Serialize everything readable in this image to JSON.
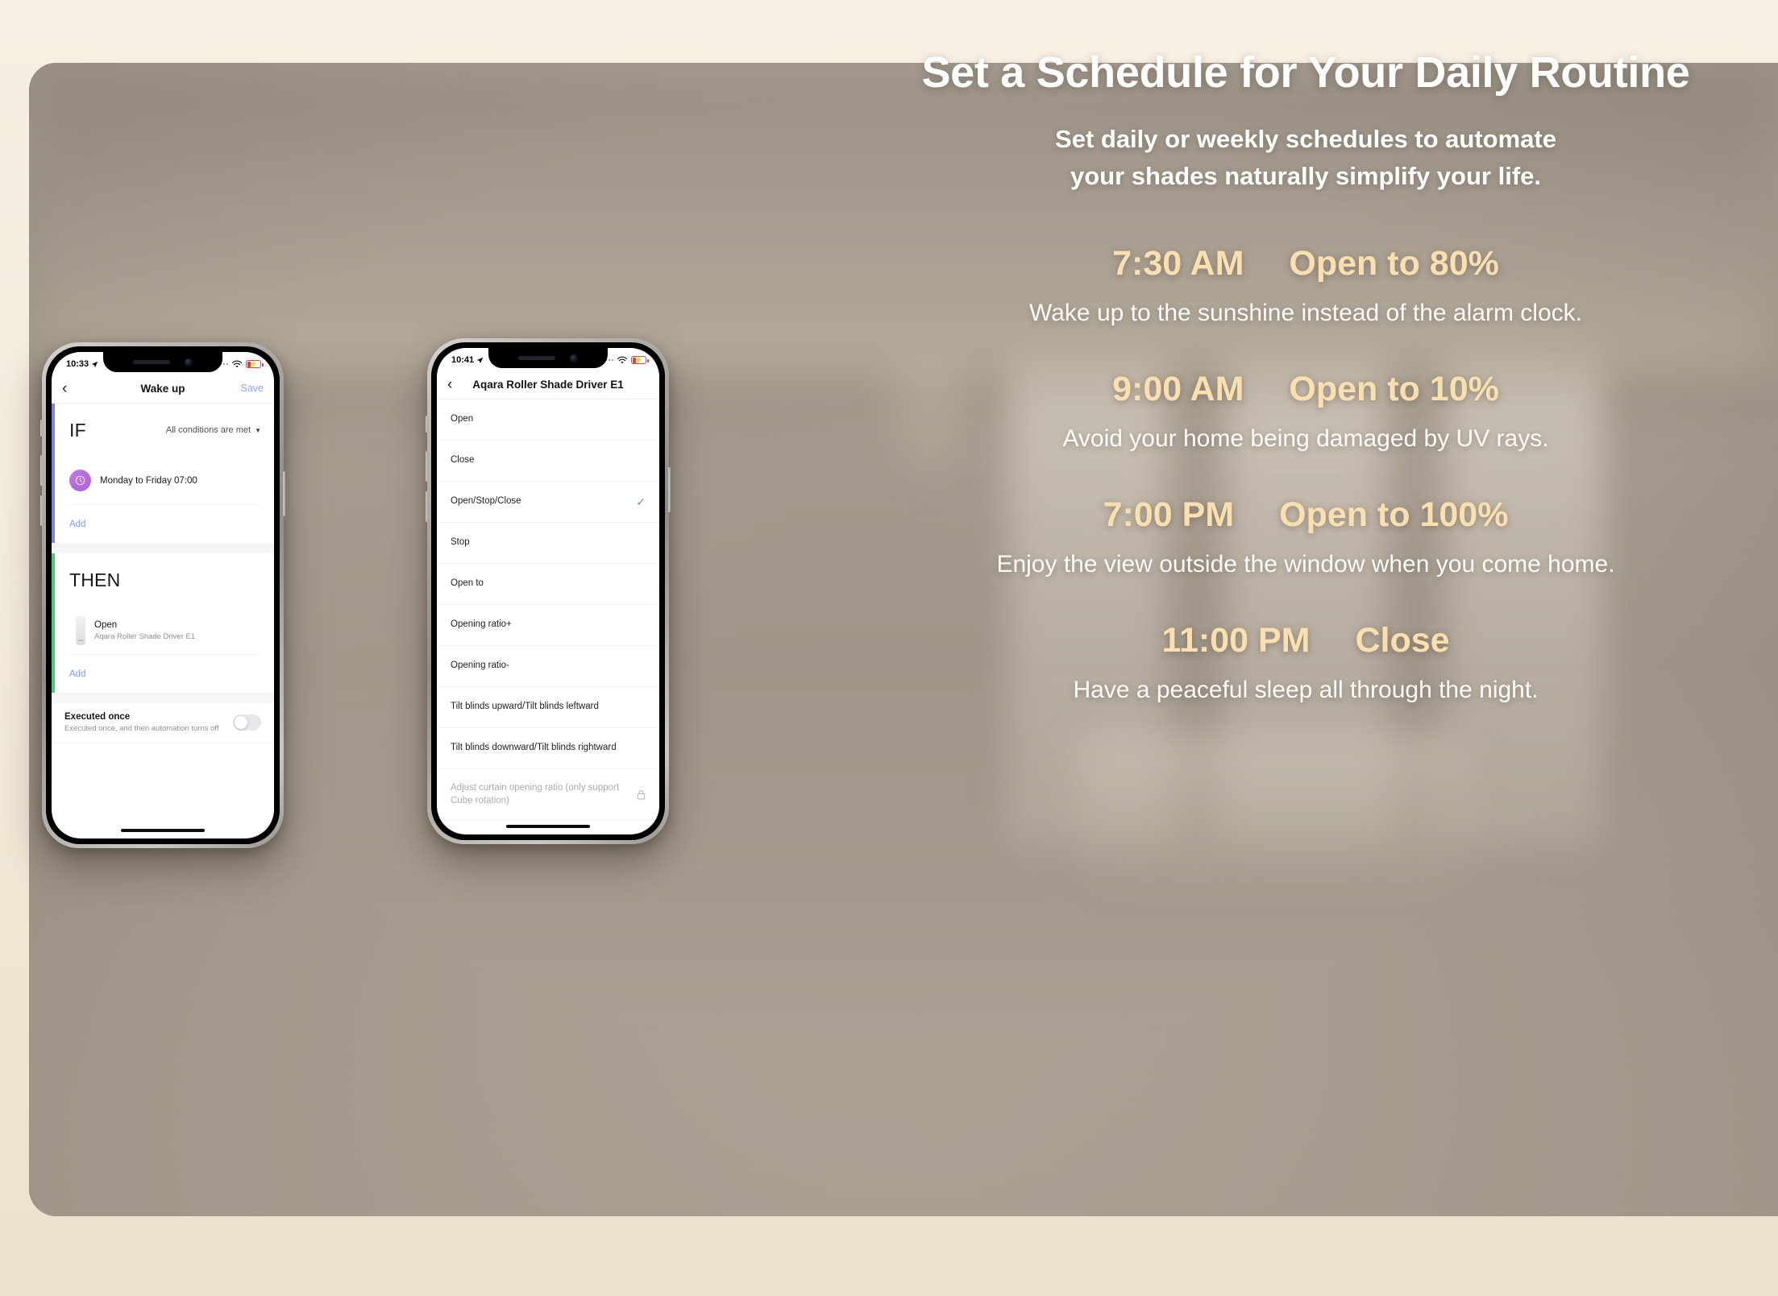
{
  "hero": {
    "headline": "Set a Schedule for Your Daily Routine",
    "subhead_line1": "Set daily or weekly schedules to automate",
    "subhead_line2": "your shades naturally simplify your life.",
    "accent_color": "#fadfb0",
    "text_color": "#ffffff"
  },
  "schedule": [
    {
      "time": "7:30 AM",
      "action": "Open to 80%",
      "description": "Wake up to the sunshine instead of the alarm clock."
    },
    {
      "time": "9:00 AM",
      "action": "Open to 10%",
      "description": "Avoid your home being damaged by UV rays."
    },
    {
      "time": "7:00 PM",
      "action": "Open to 100%",
      "description": "Enjoy the view outside the window when you come home."
    },
    {
      "time": "11:00 PM",
      "action": "Close",
      "description": "Have a peaceful sleep all through the night."
    }
  ],
  "phone1": {
    "status": {
      "time": "10:33"
    },
    "nav": {
      "back": "‹",
      "title": "Wake up",
      "save": "Save"
    },
    "if_section": {
      "title": "IF",
      "condition_mode": "All conditions are met",
      "trigger": "Monday to Friday 07:00",
      "add_label": "Add",
      "accent": "#7b85e0"
    },
    "then_section": {
      "title": "THEN",
      "action_title": "Open",
      "action_device": "Aqara Roller Shade Driver E1",
      "add_label": "Add",
      "accent": "#4ccb7f"
    },
    "executed_once": {
      "title": "Executed once",
      "subtitle": "Executed once, and then automation turns off",
      "enabled": false
    }
  },
  "phone2": {
    "status": {
      "time": "10:41"
    },
    "nav": {
      "back": "‹",
      "title": "Aqara Roller Shade Driver E1"
    },
    "options": [
      {
        "label": "Open",
        "selected": false,
        "locked": false
      },
      {
        "label": "Close",
        "selected": false,
        "locked": false
      },
      {
        "label": "Open/Stop/Close",
        "selected": true,
        "locked": false
      },
      {
        "label": "Stop",
        "selected": false,
        "locked": false
      },
      {
        "label": "Open to",
        "selected": false,
        "locked": false
      },
      {
        "label": "Opening ratio+",
        "selected": false,
        "locked": false
      },
      {
        "label": "Opening ratio-",
        "selected": false,
        "locked": false
      },
      {
        "label": "Tilt blinds upward/Tilt blinds leftward",
        "selected": false,
        "locked": false
      },
      {
        "label": "Tilt blinds downward/Tilt blinds rightward",
        "selected": false,
        "locked": false
      },
      {
        "label": "Adjust curtain opening ratio (only support Cube rotation)",
        "selected": false,
        "locked": true
      }
    ],
    "check_color": "#5a8ee0"
  }
}
